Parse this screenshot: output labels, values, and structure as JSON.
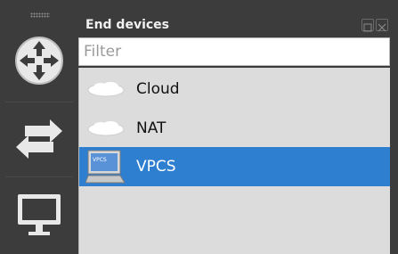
{
  "dock": {
    "title": "End devices",
    "filter_placeholder": "Filter"
  },
  "toolbar": {
    "buttons": [
      {
        "name": "routers",
        "icon": "router-icon"
      },
      {
        "name": "switches",
        "icon": "switch-arrows-icon"
      },
      {
        "name": "end-devices",
        "icon": "monitor-icon"
      }
    ]
  },
  "devices": [
    {
      "label": "Cloud",
      "icon": "cloud-icon",
      "selected": false
    },
    {
      "label": "NAT",
      "icon": "cloud-icon",
      "selected": false
    },
    {
      "label": "VPCS",
      "icon": "vpcs-computer-icon",
      "icon_text": "VPCS",
      "selected": true
    }
  ],
  "colors": {
    "selection": "#2f7fd0",
    "toolbar_bg": "#3c3c3c",
    "list_bg": "#dcdcdc"
  }
}
